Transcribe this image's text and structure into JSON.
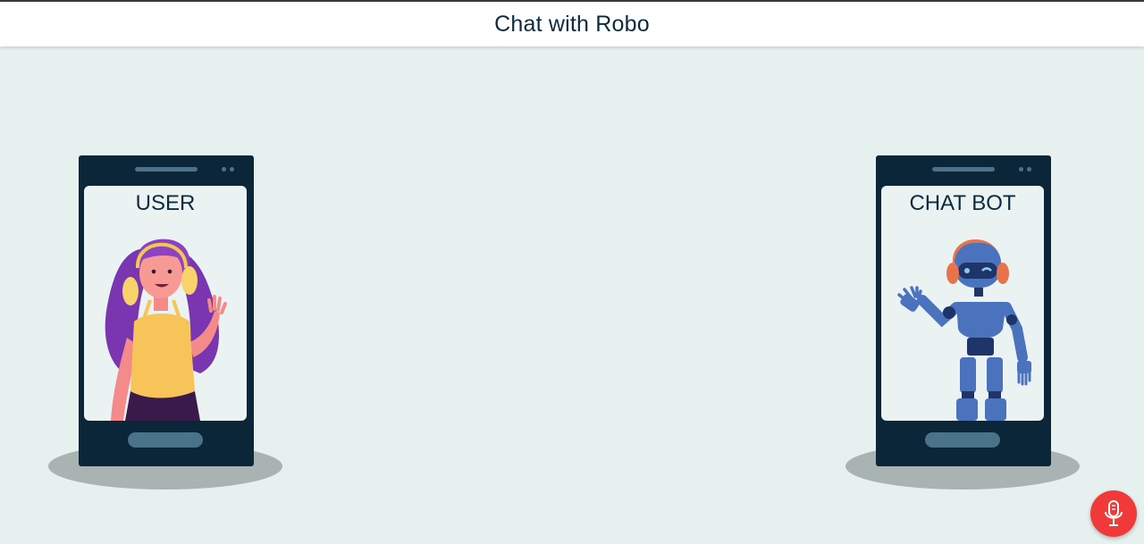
{
  "header": {
    "title": "Chat with Robo"
  },
  "user_phone": {
    "label": "USER",
    "illustration": "woman-with-headphones-waving"
  },
  "bot_phone": {
    "label": "CHAT BOT",
    "illustration": "robot-with-headphones-waving"
  },
  "mic_button": {
    "icon": "microphone-icon",
    "color": "#f03a3a"
  },
  "colors": {
    "background": "#e6f0ef",
    "phone_body": "#0b2638",
    "screen": "#eaf2f2",
    "accent": "#4a7389"
  }
}
